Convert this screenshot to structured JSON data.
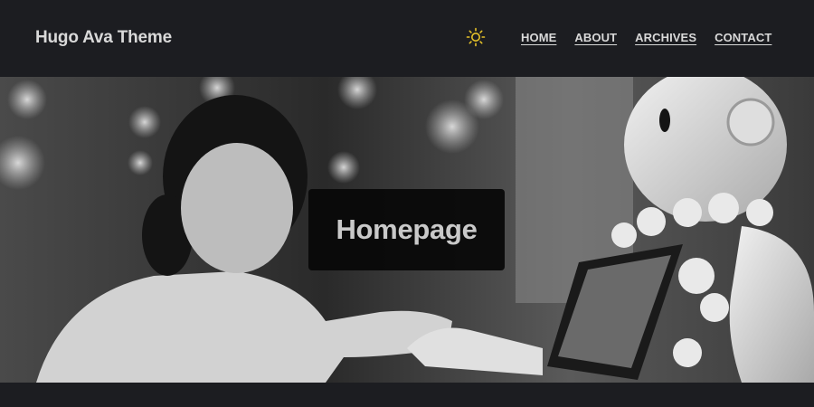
{
  "header": {
    "site_title": "Hugo Ava Theme",
    "theme_toggle_icon": "sun-icon",
    "accent_color": "#e6c229",
    "nav": [
      {
        "label": "HOME"
      },
      {
        "label": "ABOUT"
      },
      {
        "label": "ARCHIVES"
      },
      {
        "label": "CONTACT"
      }
    ]
  },
  "hero": {
    "title": "Homepage",
    "image": "grayscale photo of a young girl holding hands with a humanoid robot"
  }
}
